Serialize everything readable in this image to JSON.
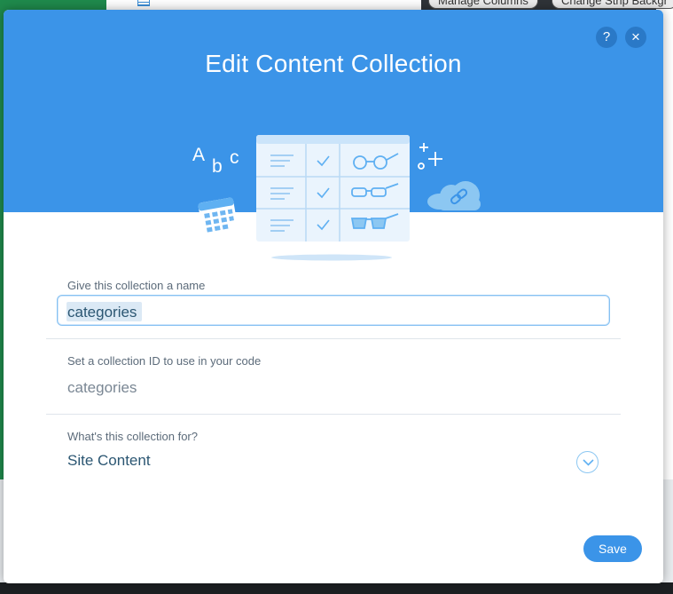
{
  "background": {
    "toolbar": {
      "manage_columns": "Manage Columns",
      "change_strip": "Change Strip Backgr"
    }
  },
  "dialog": {
    "title": "Edit Content Collection",
    "help_icon": "?",
    "close_icon": "×",
    "name_field": {
      "label": "Give this collection a name",
      "value": "categories"
    },
    "id_field": {
      "label": "Set a collection ID to use in your code",
      "value": "categories"
    },
    "purpose_field": {
      "label": "What's this collection for?",
      "value": "Site Content"
    },
    "save_label": "Save",
    "illustration_letters": {
      "a": "A",
      "b": "b",
      "c": "c"
    }
  },
  "colors": {
    "accent": "#3b94e8",
    "header_dark": "#2a79c7",
    "text": "#2b5672",
    "label": "#5c6b7a"
  },
  "icons": [
    "table-icon",
    "help-icon",
    "close-icon",
    "calendar-icon",
    "cloud-link-icon",
    "chevron-down-icon"
  ]
}
